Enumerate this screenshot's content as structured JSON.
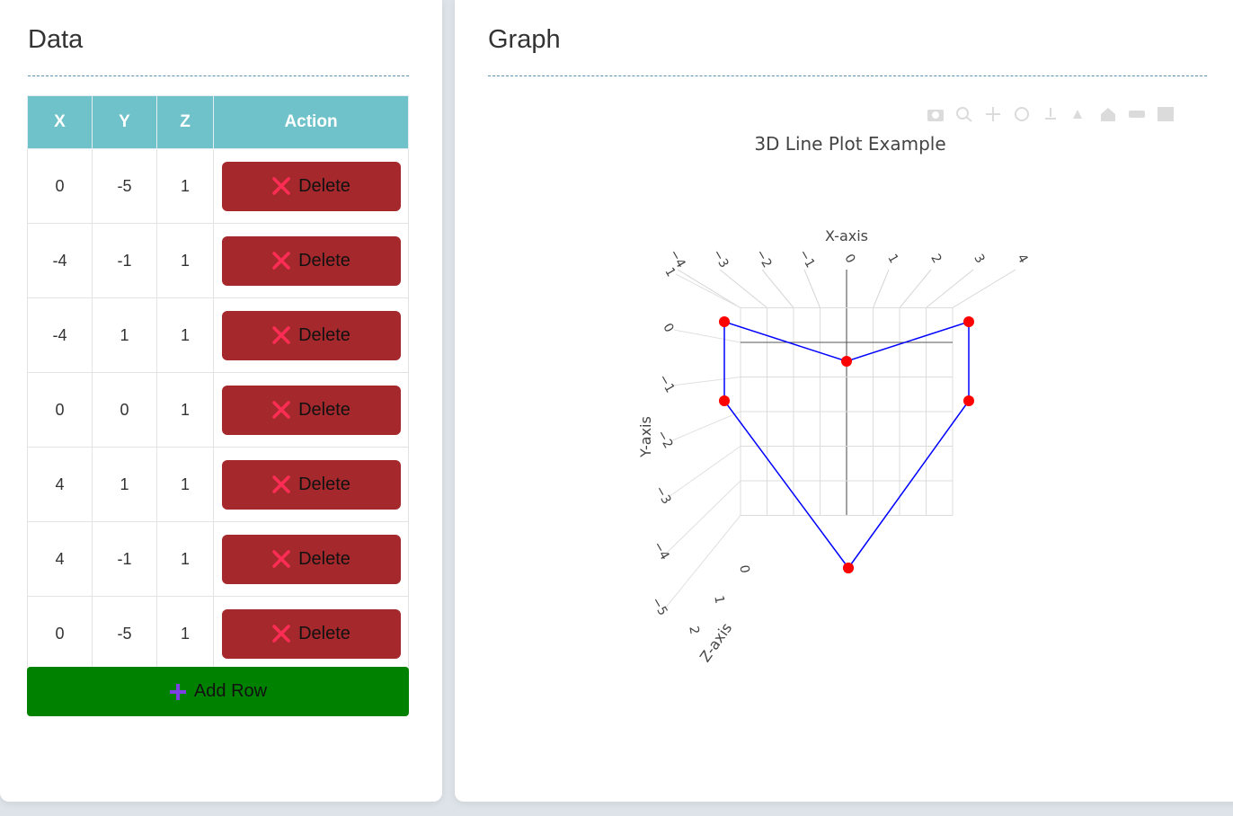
{
  "data_panel": {
    "title": "Data",
    "headers": [
      "X",
      "Y",
      "Z",
      "Action"
    ],
    "rows": [
      {
        "x": "0",
        "y": "-5",
        "z": "1"
      },
      {
        "x": "-4",
        "y": "-1",
        "z": "1"
      },
      {
        "x": "-4",
        "y": "1",
        "z": "1"
      },
      {
        "x": "0",
        "y": "0",
        "z": "1"
      },
      {
        "x": "4",
        "y": "1",
        "z": "1"
      },
      {
        "x": "4",
        "y": "-1",
        "z": "1"
      },
      {
        "x": "0",
        "y": "-5",
        "z": "1"
      }
    ],
    "delete_label": "Delete",
    "add_label": "Add Row"
  },
  "graph_panel": {
    "title": "Graph"
  },
  "colors": {
    "header_bg": "#6fc2c9",
    "delete_bg": "#a5292c",
    "delete_icon": "#ff2d55",
    "add_bg": "#008200",
    "add_icon": "#7b3fe4",
    "line": "#0000ff",
    "marker": "#ff0000"
  },
  "chart_data": {
    "type": "line",
    "dimensions": "3d",
    "title": "3D Line Plot Example",
    "xlabel": "X-axis",
    "ylabel": "Y-axis",
    "zlabel": "Z-axis",
    "x_ticks": [
      "−4",
      "−3",
      "−2",
      "−1",
      "0",
      "1",
      "2",
      "3",
      "4"
    ],
    "y_ticks": [
      "1",
      "0",
      "−1",
      "−2",
      "−3",
      "−4",
      "−5"
    ],
    "z_ticks": [
      "0",
      "1",
      "2"
    ],
    "series": [
      {
        "x": [
          0,
          -4,
          -4,
          0,
          4,
          4,
          0
        ],
        "y": [
          -5,
          -1,
          1,
          0,
          1,
          -1,
          -5
        ],
        "z": [
          1,
          1,
          1,
          1,
          1,
          1,
          1
        ]
      }
    ]
  }
}
